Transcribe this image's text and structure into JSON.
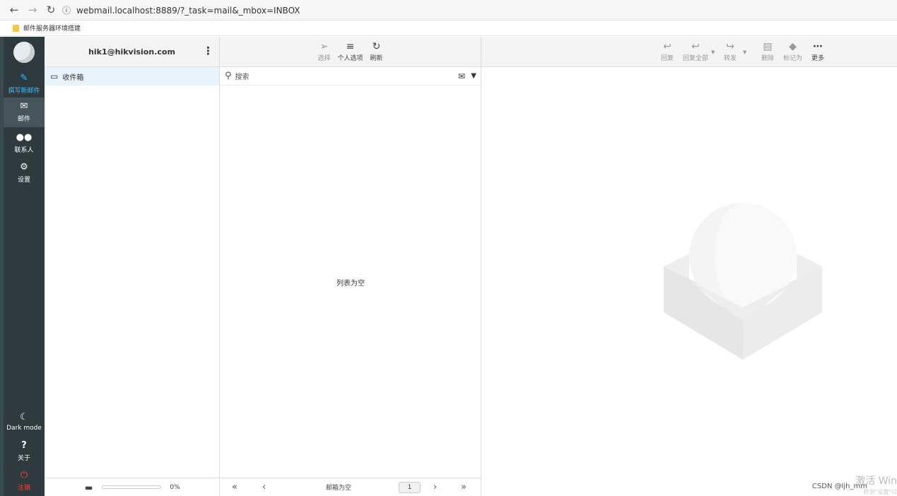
{
  "browser": {
    "url": "webmail.localhost:8889/?_task=mail&_mbox=INBOX",
    "bookmark_label": "邮件服务器环境搭建"
  },
  "sidebar": {
    "compose_label": "撰写新邮件",
    "mail_label": "邮件",
    "contacts_label": "联系人",
    "settings_label": "设置",
    "dark_mode_label": "Dark mode",
    "about_label": "关于",
    "logout_label": "注销"
  },
  "folders": {
    "account": "hik1@hikvision.com",
    "items": [
      {
        "label": "收件箱"
      }
    ],
    "quota_percent": "0%"
  },
  "list": {
    "toolbar": {
      "select": "选择",
      "options": "个人选项",
      "refresh": "刷新"
    },
    "search_placeholder": "搜索",
    "empty_text": "列表为空",
    "pager_status": "邮箱为空",
    "page_number": "1"
  },
  "message_toolbar": {
    "reply": "回复",
    "reply_all": "回复全部",
    "forward": "转发",
    "delete": "删除",
    "mark": "标记为",
    "more": "更多"
  },
  "overlay": {
    "csdn": "CSDN @ljh_mm",
    "windows_activation": "激活 Win",
    "windows_activation_sub": "转到\"设置\"以"
  }
}
